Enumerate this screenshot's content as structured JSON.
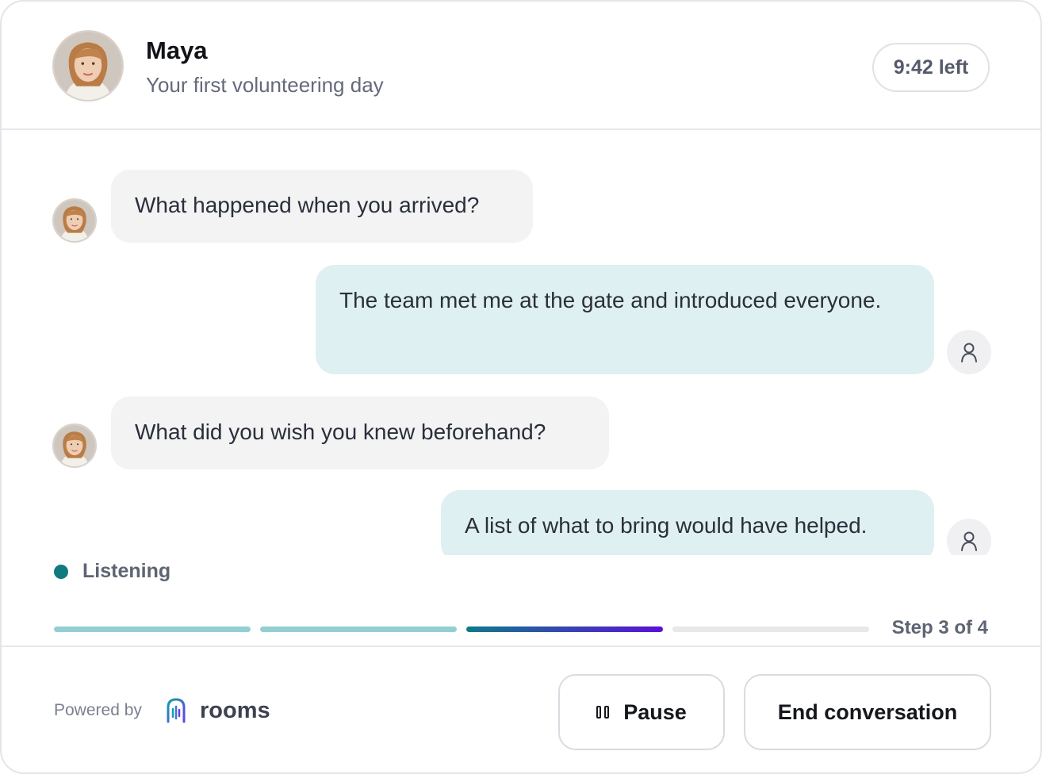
{
  "header": {
    "name": "Maya",
    "subtitle": "Your first volunteering day",
    "timer": "9:42 left",
    "avatar_icon": "maya-avatar-photo"
  },
  "messages": [
    {
      "role": "agent",
      "text": "What happened when you arrived?"
    },
    {
      "role": "user",
      "text": "The team met me at the gate and introduced everyone."
    },
    {
      "role": "agent",
      "text": "What did you wish you knew beforehand?"
    },
    {
      "role": "user",
      "text": "A list of what to bring would have helped."
    }
  ],
  "status": {
    "text": "Listening",
    "color": "#0f7a80"
  },
  "progress": {
    "current_step": 3,
    "total_steps": 4,
    "label": "Step 3 of 4"
  },
  "footer": {
    "powered_by": "Powered by",
    "brand": "rooms",
    "pause_label": "Pause",
    "end_label": "End conversation"
  },
  "colors": {
    "accent_teal": "#93cfd2",
    "gradient_start": "#0f7a8a",
    "gradient_end": "#5b10d8",
    "user_bubble": "#dff0f2",
    "agent_bubble": "#f3f3f4"
  }
}
